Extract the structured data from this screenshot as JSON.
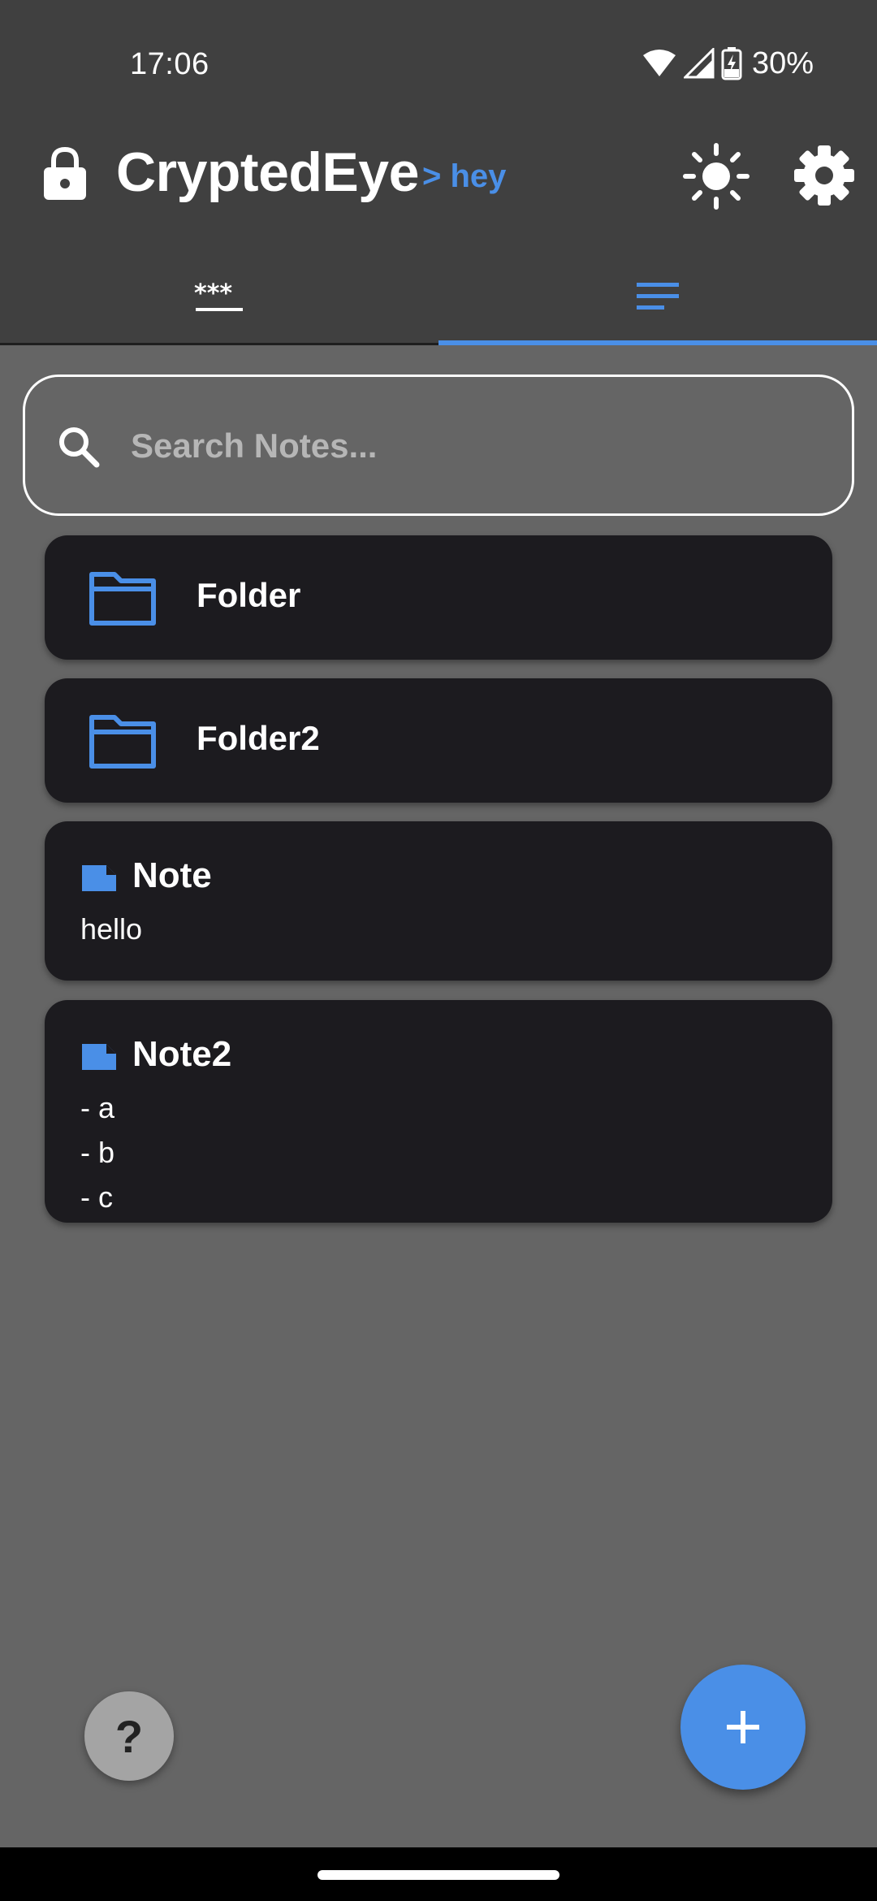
{
  "status_bar": {
    "time": "17:06",
    "battery": "30%",
    "icons": [
      "wifi-icon",
      "cell-signal-icon",
      "battery-charging-icon"
    ]
  },
  "app_bar": {
    "title": "CryptedEye",
    "subtitle": "> hey",
    "icons": [
      "lock-icon",
      "brightness-icon",
      "settings-icon"
    ]
  },
  "tabs": [
    {
      "icon": "password-icon",
      "active": false
    },
    {
      "icon": "notes-list-icon",
      "active": true
    }
  ],
  "search": {
    "placeholder": "Search Notes..."
  },
  "items": {
    "folders": [
      {
        "name": "Folder"
      },
      {
        "name": "Folder2"
      }
    ],
    "notes": [
      {
        "title": "Note",
        "body": "hello"
      },
      {
        "title": "Note2",
        "body": "- a\n- b\n- c"
      }
    ]
  },
  "fab": {
    "help_label": "?",
    "add_icon": "plus-icon"
  },
  "colors": {
    "accent": "#4a8fe7",
    "background": "#656565",
    "bar": "#404040",
    "card": "#1c1b1f"
  }
}
